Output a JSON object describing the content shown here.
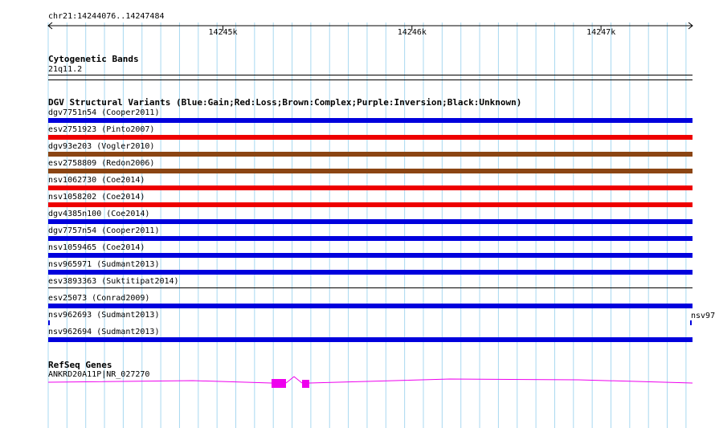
{
  "ruler": {
    "location": "chr21:14244076..14247484",
    "ticks": [
      {
        "label": "14245k",
        "pos": 14245000
      },
      {
        "label": "14246k",
        "pos": 14246000
      },
      {
        "label": "14247k",
        "pos": 14247000
      }
    ],
    "start": 14244076,
    "end": 14247484
  },
  "cytoband": {
    "title": "Cytogenetic Bands",
    "band": "21q11.2"
  },
  "dgv": {
    "title": "DGV Structural Variants (Blue:Gain;Red:Loss;Brown:Complex;Purple:Inversion;Black:Unknown)",
    "colors": {
      "Gain": "#0000dd",
      "Loss": "#ee0000",
      "Complex": "#8b4513",
      "Unknown": "#000000"
    },
    "variants": [
      {
        "label": "dgv7751n54 (Cooper2011)",
        "type": "Gain"
      },
      {
        "label": "esv2751923 (Pinto2007)",
        "type": "Loss"
      },
      {
        "label": "dgv93e203 (Vogler2010)",
        "type": "Complex"
      },
      {
        "label": "esv2758809 (Redon2006)",
        "type": "Complex"
      },
      {
        "label": "nsv1062730 (Coe2014)",
        "type": "Loss"
      },
      {
        "label": "nsv1058202 (Coe2014)",
        "type": "Loss"
      },
      {
        "label": "dgv4385n100 (Coe2014)",
        "type": "Gain"
      },
      {
        "label": "dgv7757n54 (Cooper2011)",
        "type": "Gain"
      },
      {
        "label": "nsv1059465 (Coe2014)",
        "type": "Gain"
      },
      {
        "label": "nsv965971 (Sudmant2013)",
        "type": "Gain"
      },
      {
        "label": "esv3893363 (Suktitipat2014)",
        "type": "Unknown"
      },
      {
        "label": "esv25073 (Conrad2009)",
        "type": "Gain"
      },
      {
        "label": "nsv962693 (Sudmant2013)",
        "type": "Gain"
      },
      {
        "label": "nsv962694 (Sudmant2013)",
        "type": "Gain"
      }
    ],
    "side_label": "nsv97"
  },
  "refseq": {
    "title": "RefSeq Genes",
    "gene_label": "ANKRD20A11P|NR_027270",
    "color": "#ee00ee"
  }
}
